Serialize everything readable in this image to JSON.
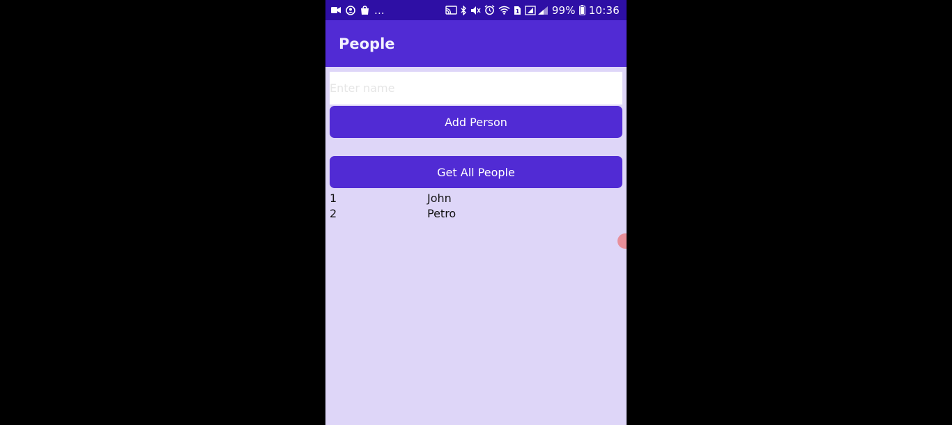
{
  "status_bar": {
    "battery": "99%",
    "time": "10:36",
    "more": "...",
    "icons_left": [
      "video-icon",
      "account-circle-icon",
      "shopping-bag-icon"
    ],
    "icons_right": [
      "cast-icon",
      "bluetooth-icon",
      "mute-icon",
      "alarm-icon",
      "wifi-icon",
      "sim-icon",
      "signal-icon",
      "battery-icon"
    ]
  },
  "app_bar": {
    "title": "People"
  },
  "form": {
    "name_placeholder": "Enter name",
    "name_value": "",
    "add_button_label": "Add Person",
    "get_button_label": "Get All People"
  },
  "people": [
    {
      "id": "1",
      "name": "John"
    },
    {
      "id": "2",
      "name": "Petro"
    }
  ],
  "colors": {
    "status_bar": "#2e0fa5",
    "primary": "#512bd4",
    "background": "#ded6f8",
    "touch_indicator": "#e88f9a"
  }
}
